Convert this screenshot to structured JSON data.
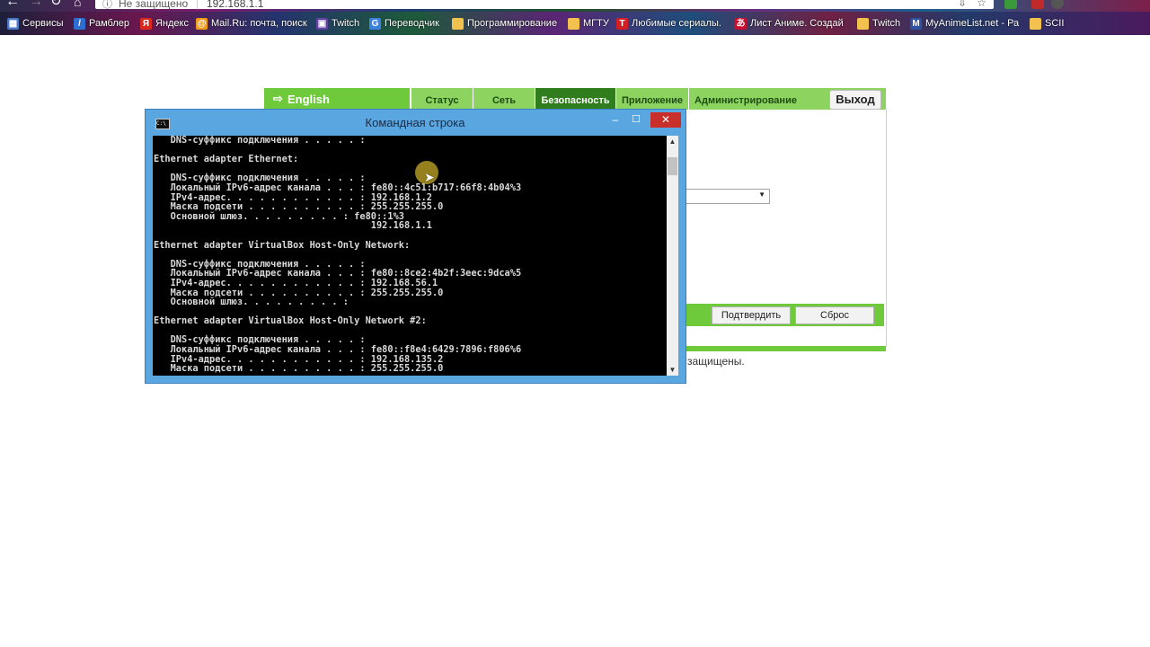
{
  "browser": {
    "security_label": "Не защищено",
    "separator": "|",
    "url": "192.168.1.1",
    "bookmarks": [
      {
        "label": "Сервисы",
        "icon": "apps-grid-icon",
        "icon_color": "#4a78c9",
        "glyph": "▦"
      },
      {
        "label": "Рамблер",
        "icon": "rambler-icon",
        "icon_color": "#2d6fd1",
        "glyph": "/"
      },
      {
        "label": "Яндекс",
        "icon": "yandex-icon",
        "icon_color": "#d9291c",
        "glyph": "Я"
      },
      {
        "label": "Mail.Ru: почта, поиск",
        "icon": "mailru-icon",
        "icon_color": "#f29a1a",
        "glyph": "@"
      },
      {
        "label": "Twitch",
        "icon": "twitch-icon",
        "icon_color": "#6441a5",
        "glyph": "▣"
      },
      {
        "label": "Переводчик",
        "icon": "translate-icon",
        "icon_color": "#3b82e0",
        "glyph": "G"
      },
      {
        "label": "Программирование",
        "icon": "folder-icon",
        "icon_color": "#f2c14e",
        "glyph": ""
      },
      {
        "label": "МГТУ",
        "icon": "folder-icon",
        "icon_color": "#f2c14e",
        "glyph": ""
      },
      {
        "label": "Любимые сериалы.",
        "icon": "tv-icon",
        "icon_color": "#d21f26",
        "glyph": "T"
      },
      {
        "label": "Лист Аниме. Создай",
        "icon": "anime-list-icon",
        "icon_color": "#c8102e",
        "glyph": "あ"
      },
      {
        "label": "Twitch",
        "icon": "folder-icon",
        "icon_color": "#f2c14e",
        "glyph": ""
      },
      {
        "label": "MyAnimeList.net - Ра",
        "icon": "myanimelist-icon",
        "icon_color": "#2e51a2",
        "glyph": "M"
      },
      {
        "label": "SCII",
        "icon": "folder-icon",
        "icon_color": "#f2c14e",
        "glyph": ""
      }
    ]
  },
  "router": {
    "language": "English",
    "tabs": [
      "Статус",
      "Сеть",
      "Безопасность",
      "Приложение",
      "Администрирование"
    ],
    "active_tab": "Безопасность",
    "logout_label": "Выход",
    "confirm_label": "Подтвердить",
    "reset_label": "Сброс",
    "footer_fragment": "защищены.",
    "accent_color": "#6fca3b"
  },
  "cmd": {
    "title": "Командная строка",
    "lines": [
      "   DNS-суффикс подключения . . . . . :",
      "",
      "Ethernet adapter Ethernet:",
      "",
      "   DNS-суффикс подключения . . . . . :",
      "   Локальный IPv6-адрес канала . . . : fe80::4c51:b717:66f8:4b04%3",
      "   IPv4-адрес. . . . . . . . . . . . : 192.168.1.2",
      "   Маска подсети . . . . . . . . . . : 255.255.255.0",
      "   Основной шлюз. . . . . . . . . : fe80::1%3",
      "                                       192.168.1.1",
      "",
      "Ethernet adapter VirtualBox Host-Only Network:",
      "",
      "   DNS-суффикс подключения . . . . . :",
      "   Локальный IPv6-адрес канала . . . : fe80::8ce2:4b2f:3eec:9dca%5",
      "   IPv4-адрес. . . . . . . . . . . . : 192.168.56.1",
      "   Маска подсети . . . . . . . . . . : 255.255.255.0",
      "   Основной шлюз. . . . . . . . . :",
      "",
      "Ethernet adapter VirtualBox Host-Only Network #2:",
      "",
      "   DNS-суффикс подключения . . . . . :",
      "   Локальный IPv6-адрес канала . . . : fe80::f8e4:6429:7896:f806%6",
      "   IPv4-адрес. . . . . . . . . . . . : 192.168.135.2",
      "   Маска подсети . . . . . . . . . . : 255.255.255.0"
    ]
  }
}
